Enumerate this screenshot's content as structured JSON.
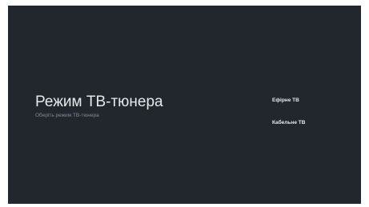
{
  "screen": {
    "title": "Режим ТВ-тюнера",
    "subtitle": "Оберіть режим ТВ-тюнера"
  },
  "options": [
    {
      "label": "Ефірне ТВ"
    },
    {
      "label": "Кабельне ТВ"
    }
  ],
  "colors": {
    "background": "#21272c",
    "title_text": "#e6e8ea",
    "subtitle_text": "#838b93"
  }
}
